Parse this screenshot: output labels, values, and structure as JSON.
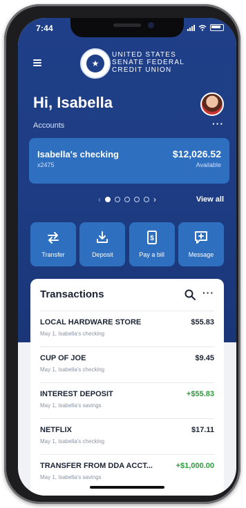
{
  "status": {
    "time": "7:44"
  },
  "brand": {
    "line1": "UNITED STATES",
    "line2": "SENATE FEDERAL",
    "line3": "CREDIT UNION"
  },
  "greeting": "Hi, Isabella",
  "accounts": {
    "label": "Accounts",
    "more": "···",
    "card": {
      "name": "Isabella's checking",
      "number": "x2475",
      "balance": "$12,026.52",
      "balance_label": "Available"
    },
    "pager": {
      "prev": "‹",
      "next": "›",
      "view_all": "View all"
    }
  },
  "actions": [
    {
      "label": "Transfer",
      "icon": "transfer-icon"
    },
    {
      "label": "Deposit",
      "icon": "deposit-icon"
    },
    {
      "label": "Pay a bill",
      "icon": "bill-icon"
    },
    {
      "label": "Message",
      "icon": "message-icon"
    }
  ],
  "transactions": {
    "title": "Transactions",
    "more": "···",
    "items": [
      {
        "merchant": "LOCAL HARDWARE STORE",
        "meta": "May 1, Isabella's checking",
        "amount": "$55.83",
        "positive": false
      },
      {
        "merchant": "CUP OF JOE",
        "meta": "May 1, Isabella's checking",
        "amount": "$9.45",
        "positive": false
      },
      {
        "merchant": "INTEREST DEPOSIT",
        "meta": "May 1, Isabella's savings",
        "amount": "+$55.83",
        "positive": true
      },
      {
        "merchant": "NETFLIX",
        "meta": "May 1, Isabella's checking",
        "amount": "$17.11",
        "positive": false
      },
      {
        "merchant": "TRANSFER FROM DDA ACCT...",
        "meta": "May 1, Isabella's savings",
        "amount": "+$1,000.00",
        "positive": true
      }
    ]
  },
  "colors": {
    "primary": "#1f3f88",
    "card": "#2f6fc0",
    "positive": "#2f9a3d"
  }
}
